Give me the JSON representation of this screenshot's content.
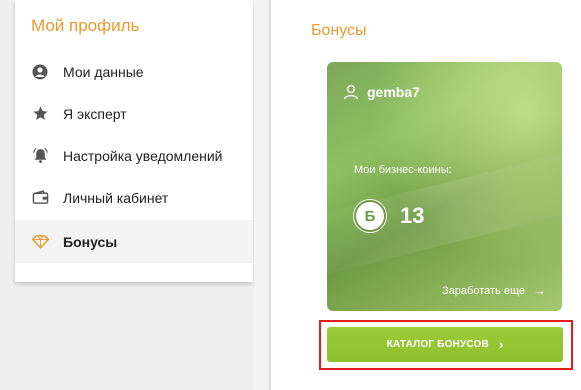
{
  "sidebar": {
    "title": "Мой профиль",
    "items": [
      {
        "label": "Мои данные",
        "icon": "user-circle-icon",
        "active": false
      },
      {
        "label": "Я эксперт",
        "icon": "star-icon",
        "active": false
      },
      {
        "label": "Настройка уведомлений",
        "icon": "bell-icon",
        "active": false
      },
      {
        "label": "Личный кабинет",
        "icon": "wallet-icon",
        "active": false
      },
      {
        "label": "Бонусы",
        "icon": "diamond-icon",
        "active": true
      }
    ]
  },
  "main": {
    "section_title": "Бонусы",
    "card": {
      "username": "gemba7",
      "coins_label": "Мои бизнес-коины:",
      "coin_symbol": "Б",
      "coin_count": "13",
      "earn_more_label": "Заработать еще",
      "earn_more_arrow": "→"
    },
    "catalog_button": {
      "label": "КАТАЛОГ БОНУСОВ",
      "chevron": "›"
    }
  },
  "colors": {
    "accent_orange": "#e89a2c",
    "card_green": "#7fa85a",
    "button_green": "#8ebf2c",
    "highlight_red": "#e21d1d"
  }
}
